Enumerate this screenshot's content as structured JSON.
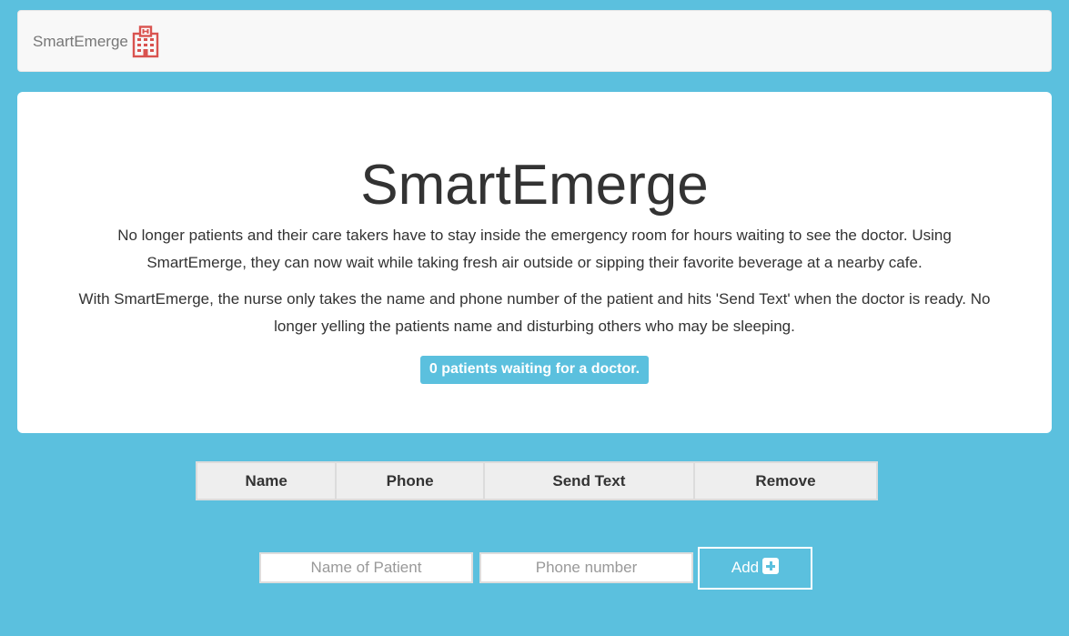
{
  "navbar": {
    "brand_label": "SmartEmerge",
    "brand_icon": "hospital-icon",
    "brand_icon_color": "#d9534f"
  },
  "jumbotron": {
    "title": "SmartEmerge",
    "paragraph1": "No longer patients and their care takers have to stay inside the emergency room for hours waiting to see the doctor. Using SmartEmerge, they can now wait while taking fresh air outside or sipping their favorite beverage at a nearby cafe.",
    "paragraph2": "With SmartEmerge, the nurse only takes the name and phone number of the patient and hits 'Send Text' when the doctor is ready. No longer yelling the patients name and disturbing others who may be sleeping.",
    "badge_text": "0 patients waiting for a doctor."
  },
  "table": {
    "columns": [
      "Name",
      "Phone",
      "Send Text",
      "Remove"
    ],
    "rows": []
  },
  "form": {
    "name_placeholder": "Name of Patient",
    "name_value": "",
    "phone_placeholder": "Phone number",
    "phone_value": "",
    "add_label": "Add",
    "add_icon": "plus-square-icon"
  },
  "colors": {
    "background": "#5bc0de",
    "accent": "#5bc0de",
    "brand_icon": "#d9534f"
  }
}
